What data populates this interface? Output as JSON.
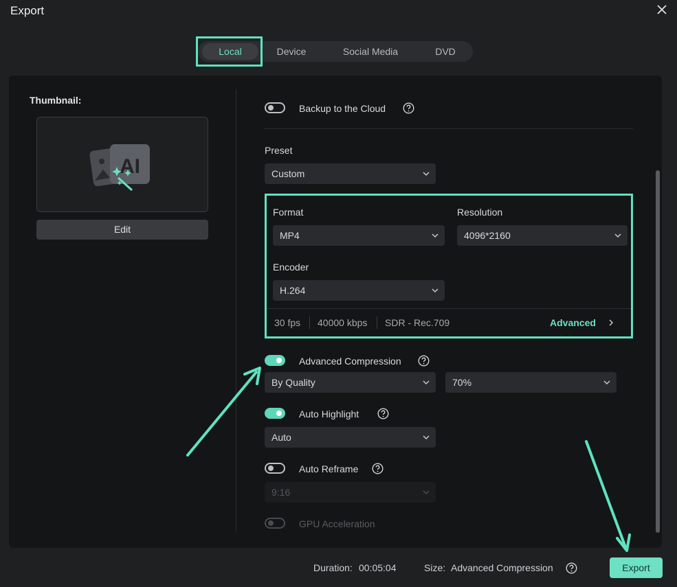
{
  "window": {
    "title": "Export"
  },
  "tabs": [
    {
      "label": "Local",
      "active": true
    },
    {
      "label": "Device",
      "active": false
    },
    {
      "label": "Social Media",
      "active": false
    },
    {
      "label": "DVD",
      "active": false
    }
  ],
  "thumbnail": {
    "label": "Thumbnail:",
    "edit_label": "Edit",
    "badge_text": "AI"
  },
  "backup": {
    "label": "Backup to the Cloud",
    "enabled": false
  },
  "preset": {
    "label": "Preset",
    "value": "Custom"
  },
  "format": {
    "label": "Format",
    "value": "MP4"
  },
  "resolution": {
    "label": "Resolution",
    "value": "4096*2160"
  },
  "encoder": {
    "label": "Encoder",
    "value": "H.264"
  },
  "stats": {
    "fps": "30 fps",
    "bitrate": "40000 kbps",
    "color": "SDR - Rec.709",
    "advanced_label": "Advanced"
  },
  "compression": {
    "label": "Advanced Compression",
    "enabled": true,
    "mode": "By Quality",
    "quality": "70%"
  },
  "highlight": {
    "label": "Auto Highlight",
    "enabled": true,
    "value": "Auto"
  },
  "reframe": {
    "label": "Auto Reframe",
    "enabled": false,
    "value": "9:16"
  },
  "gpu": {
    "label": "GPU Acceleration",
    "enabled": false
  },
  "footer": {
    "duration_label": "Duration:",
    "duration_value": "00:05:04",
    "size_label": "Size:",
    "size_value": "Advanced Compression",
    "export_label": "Export"
  },
  "colors": {
    "accent": "#6ee0c4",
    "highlight_border": "#5ee3c2",
    "background": "#1f2022",
    "panel": "#141516"
  },
  "icons": [
    "close-icon",
    "help-icon",
    "chevron-down-icon",
    "chevron-right-icon",
    "ai-image-icon",
    "magic-wand-icon"
  ]
}
